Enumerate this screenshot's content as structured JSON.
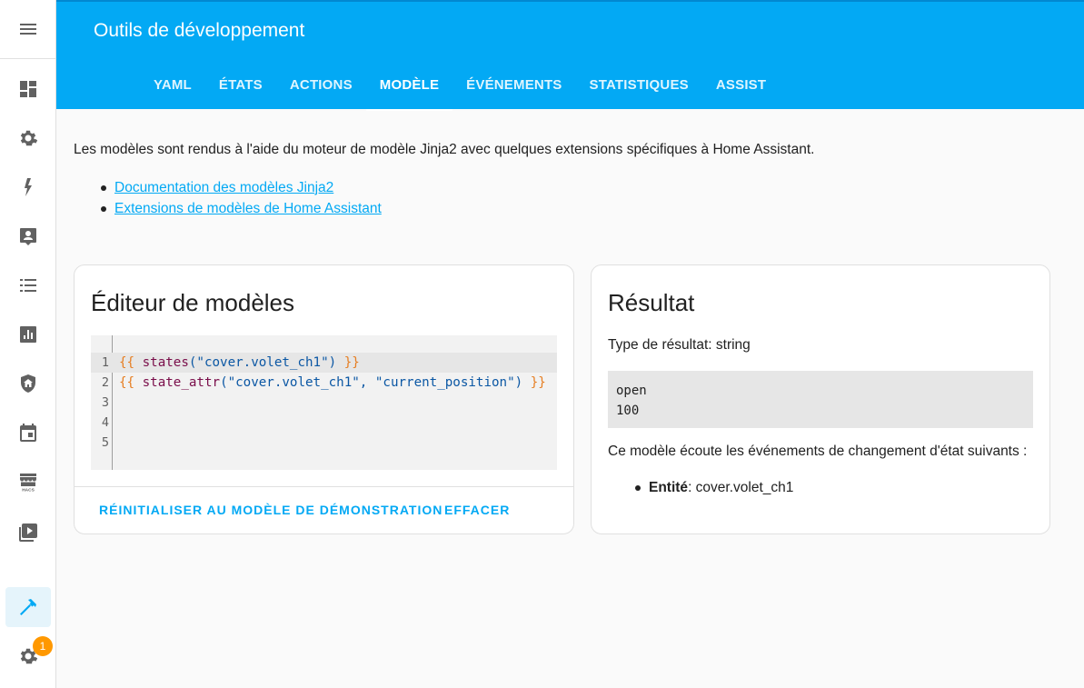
{
  "header": {
    "title": "Outils de développement",
    "tabs": [
      {
        "label": "YAML",
        "active": false
      },
      {
        "label": "ÉTATS",
        "active": false
      },
      {
        "label": "ACTIONS",
        "active": false
      },
      {
        "label": "MODÈLE",
        "active": true
      },
      {
        "label": "ÉVÉNEMENTS",
        "active": false
      },
      {
        "label": "STATISTIQUES",
        "active": false
      },
      {
        "label": "ASSIST",
        "active": false
      }
    ]
  },
  "sidebar": {
    "items": [
      {
        "icon": "dashboard-icon"
      },
      {
        "icon": "gear-icon"
      },
      {
        "icon": "lightning-icon"
      },
      {
        "icon": "person-card-icon"
      },
      {
        "icon": "list-icon"
      },
      {
        "icon": "chart-icon"
      },
      {
        "icon": "shield-home-icon"
      },
      {
        "icon": "calendar-icon"
      },
      {
        "icon": "hacs-store-icon",
        "label": "HACS"
      },
      {
        "icon": "media-icon"
      },
      {
        "icon": "hammer-icon",
        "active": true
      },
      {
        "icon": "settings-icon",
        "badge": "1"
      }
    ]
  },
  "intro": {
    "text": "Les modèles sont rendus à l'aide du moteur de modèle Jinja2 avec quelques extensions spécifiques à Home Assistant.",
    "links": [
      "Documentation des modèles Jinja2",
      "Extensions de modèles de Home Assistant"
    ]
  },
  "editor": {
    "title": "Éditeur de modèles",
    "line_numbers": [
      "1",
      "2",
      "3",
      "4",
      "5"
    ],
    "lines": [
      {
        "open": "{{",
        "fn": "states",
        "args": "(\"cover.volet_ch1\")",
        "close": "}}"
      },
      {
        "open": "{{",
        "fn": "state_attr",
        "args": "(\"cover.volet_ch1\", \"current_position\")",
        "close": "}}"
      }
    ],
    "reset_button": "RÉINITIALISER AU MODÈLE DE DÉMONSTRATION",
    "clear_button": "EFFACER"
  },
  "result": {
    "title": "Résultat",
    "type_text": "Type de résultat: string",
    "output_lines": [
      "open",
      "100"
    ],
    "listen_text": "Ce modèle écoute les événements de changement d'état suivants :",
    "entity_label": "Entité",
    "entity_value": ": cover.volet_ch1"
  },
  "colors": {
    "primary": "#03a9f4",
    "badge": "#ff9800"
  }
}
